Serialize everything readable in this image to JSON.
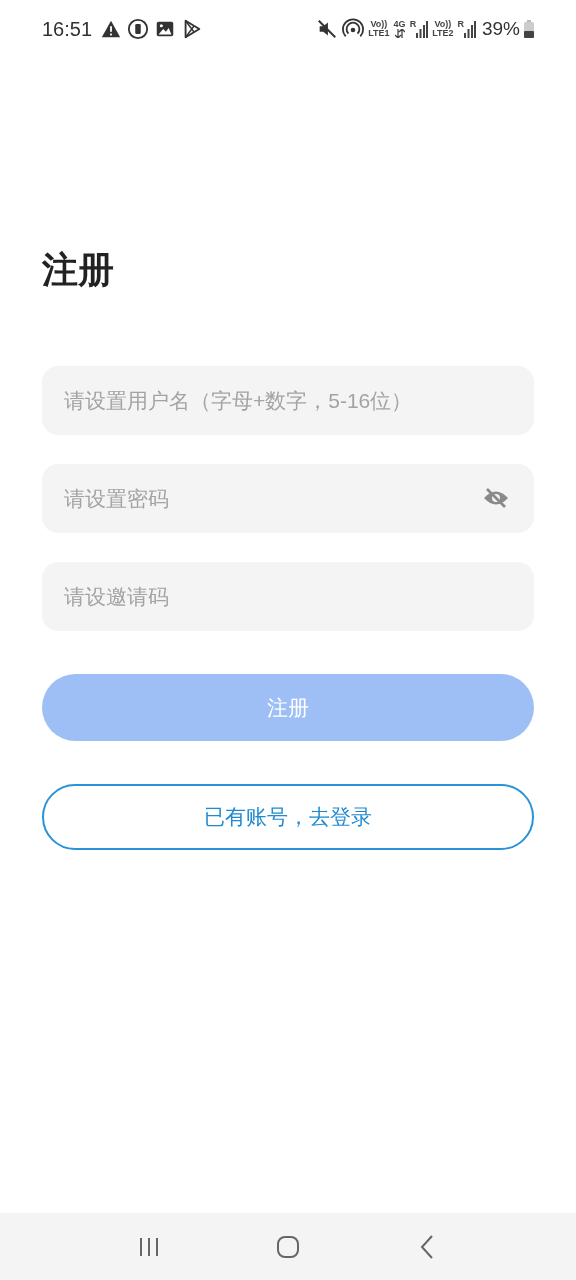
{
  "status_bar": {
    "time": "16:51",
    "sim1_top": "Vo))",
    "sim1_bottom": "LTE1",
    "data_type": "4G",
    "roaming1": "R",
    "sim2_top": "Vo))",
    "sim2_bottom": "LTE2",
    "roaming2": "R",
    "battery": "39%"
  },
  "title": "注册",
  "fields": [
    {
      "placeholder": "请设置用户名（字母+数字，5-16位）",
      "kind": "text"
    },
    {
      "placeholder": "请设置密码",
      "kind": "password",
      "password_visible": false
    },
    {
      "placeholder": "请设邀请码",
      "kind": "text"
    }
  ],
  "register_button": {
    "label": "注册",
    "disabled": true
  },
  "login_button": {
    "label": "已有账号，去登录"
  }
}
